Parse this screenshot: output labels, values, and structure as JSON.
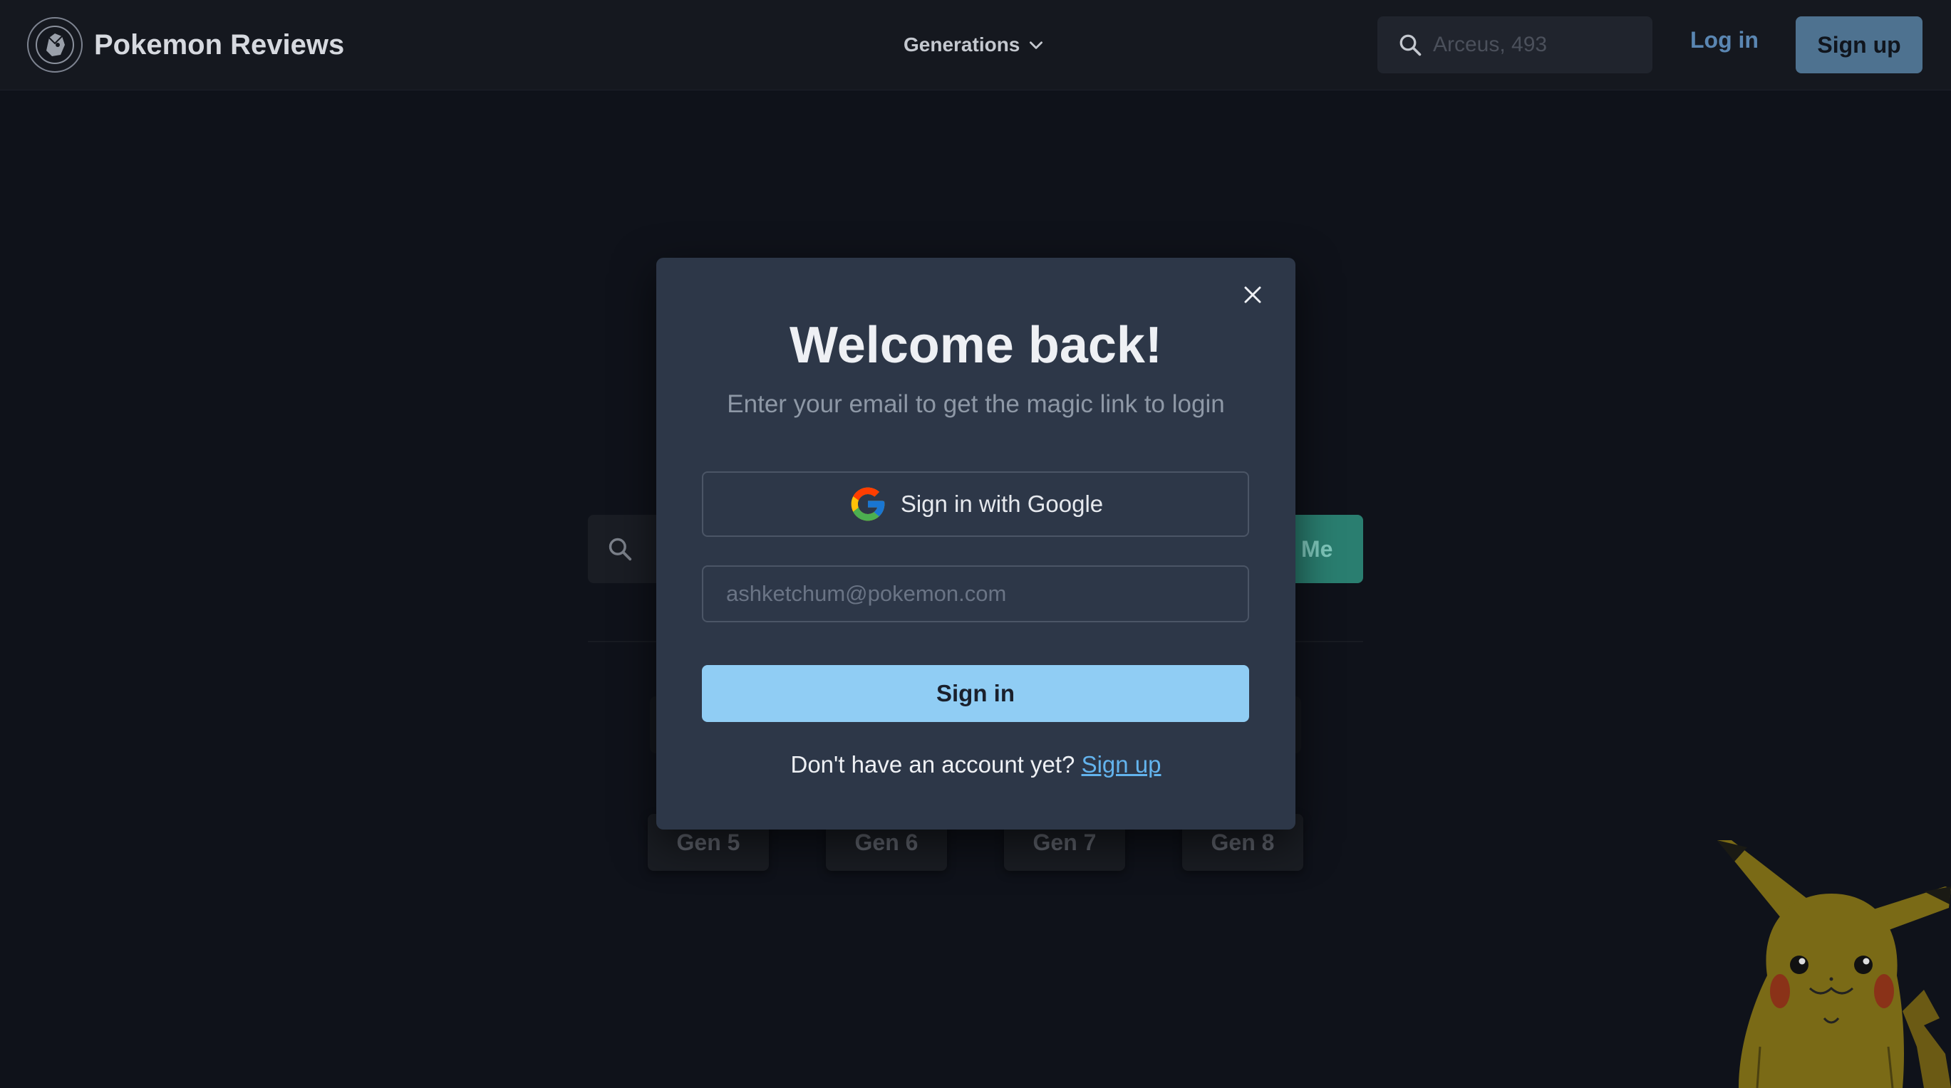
{
  "navbar": {
    "brand_name": "Pokemon Reviews",
    "generations_label": "Generations",
    "search_placeholder": "Arceus, 493",
    "login_label": "Log in",
    "signup_label": "Sign up"
  },
  "background": {
    "hero_button_label": "Me",
    "generations": [
      "Gen 5",
      "Gen 6",
      "Gen 7",
      "Gen 8"
    ]
  },
  "modal": {
    "title": "Welcome back!",
    "subtitle": "Enter your email to get the magic link to login",
    "google_button_label": "Sign in with Google",
    "email_placeholder": "ashketchum@pokemon.com",
    "signin_label": "Sign in",
    "footer_text": "Don't have an account yet?",
    "footer_link": "Sign up"
  },
  "icons": {
    "logo": "pokemon-logo-icon",
    "dropdown": "chevron-down-icon",
    "search": "search-icon",
    "close": "close-icon",
    "google": "google-icon",
    "mascot": "pikachu-illustration"
  },
  "colors": {
    "page_background": "#0f121a",
    "navbar_background": "#15181f",
    "modal_background": "#2d3748",
    "signin_button": "#90cdf4",
    "signup_button": "#4e7290",
    "link": "#63b3ed",
    "teal_accent": "#2a7e70"
  }
}
